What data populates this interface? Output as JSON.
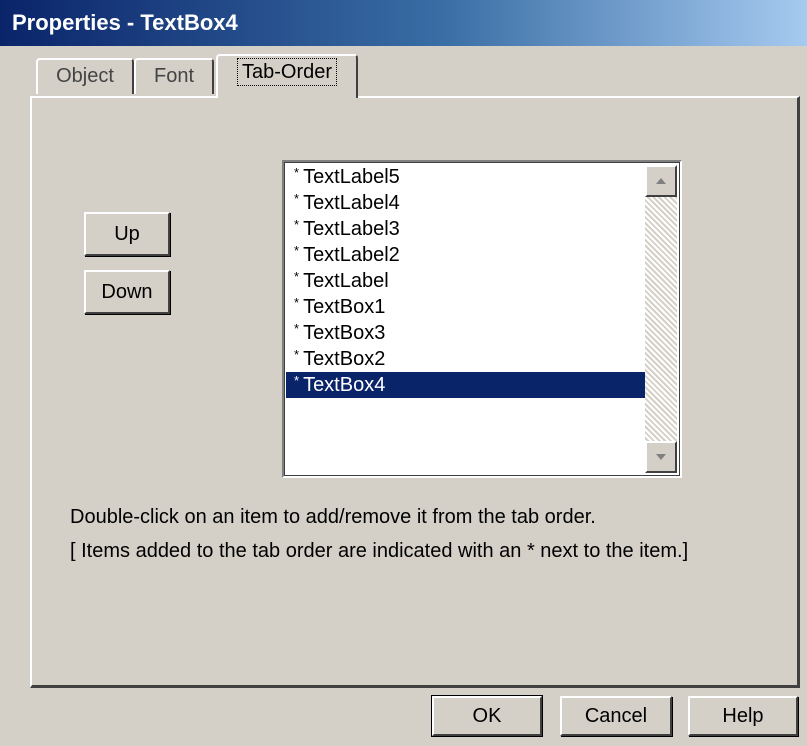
{
  "window": {
    "title": "Properties - TextBox4"
  },
  "tabs": [
    {
      "label": "Object",
      "active": false
    },
    {
      "label": "Font",
      "active": false
    },
    {
      "label": "Tab-Order",
      "active": true
    }
  ],
  "order_buttons": {
    "up": "Up",
    "down": "Down"
  },
  "list": {
    "star": "*",
    "items": [
      {
        "label": "TextLabel5",
        "selected": false
      },
      {
        "label": "TextLabel4",
        "selected": false
      },
      {
        "label": "TextLabel3",
        "selected": false
      },
      {
        "label": "TextLabel2",
        "selected": false
      },
      {
        "label": "TextLabel",
        "selected": false
      },
      {
        "label": "TextBox1",
        "selected": false
      },
      {
        "label": "TextBox3",
        "selected": false
      },
      {
        "label": "TextBox2",
        "selected": false
      },
      {
        "label": "TextBox4",
        "selected": true
      }
    ]
  },
  "hints": {
    "line1": "Double-click on an item to add/remove it from the tab order.",
    "line2": "[ Items added to the tab order are indicated with an * next to the item.]"
  },
  "footer": {
    "ok": "OK",
    "cancel": "Cancel",
    "help": "Help"
  },
  "colors": {
    "title_bar": "#0a246a",
    "selection": "#0a246a",
    "face": "#d4d0c8"
  }
}
